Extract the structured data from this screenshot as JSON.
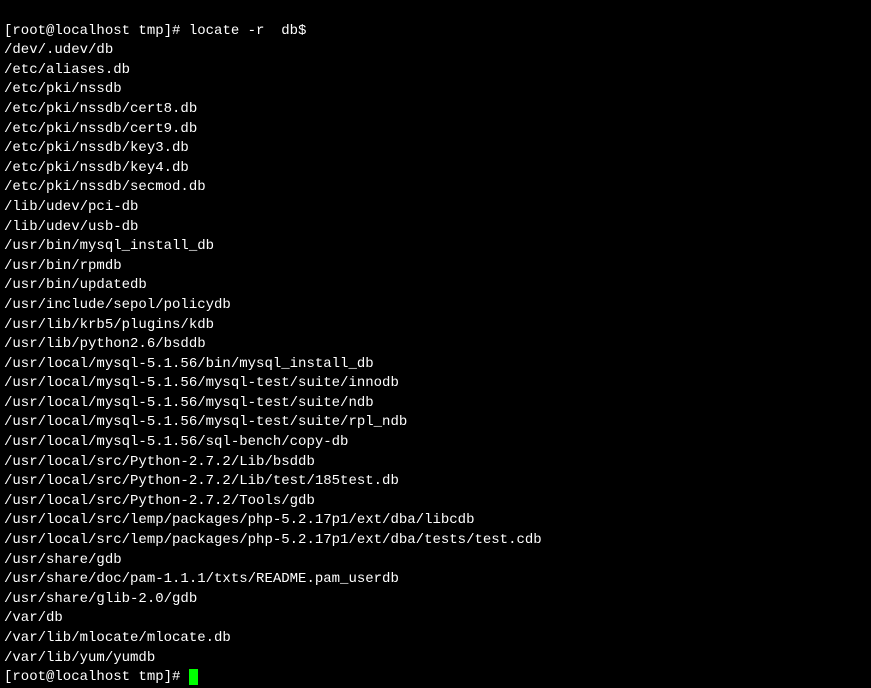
{
  "prompt1": {
    "prefix": "[root@localhost tmp]# ",
    "command": "locate -r  db$"
  },
  "output": [
    "/dev/.udev/db",
    "/etc/aliases.db",
    "/etc/pki/nssdb",
    "/etc/pki/nssdb/cert8.db",
    "/etc/pki/nssdb/cert9.db",
    "/etc/pki/nssdb/key3.db",
    "/etc/pki/nssdb/key4.db",
    "/etc/pki/nssdb/secmod.db",
    "/lib/udev/pci-db",
    "/lib/udev/usb-db",
    "/usr/bin/mysql_install_db",
    "/usr/bin/rpmdb",
    "/usr/bin/updatedb",
    "/usr/include/sepol/policydb",
    "/usr/lib/krb5/plugins/kdb",
    "/usr/lib/python2.6/bsddb",
    "/usr/local/mysql-5.1.56/bin/mysql_install_db",
    "/usr/local/mysql-5.1.56/mysql-test/suite/innodb",
    "/usr/local/mysql-5.1.56/mysql-test/suite/ndb",
    "/usr/local/mysql-5.1.56/mysql-test/suite/rpl_ndb",
    "/usr/local/mysql-5.1.56/sql-bench/copy-db",
    "/usr/local/src/Python-2.7.2/Lib/bsddb",
    "/usr/local/src/Python-2.7.2/Lib/test/185test.db",
    "/usr/local/src/Python-2.7.2/Tools/gdb",
    "/usr/local/src/lemp/packages/php-5.2.17p1/ext/dba/libcdb",
    "/usr/local/src/lemp/packages/php-5.2.17p1/ext/dba/tests/test.cdb",
    "/usr/share/gdb",
    "/usr/share/doc/pam-1.1.1/txts/README.pam_userdb",
    "/usr/share/glib-2.0/gdb",
    "/var/db",
    "/var/lib/mlocate/mlocate.db",
    "/var/lib/yum/yumdb"
  ],
  "prompt2": {
    "prefix": "[root@localhost tmp]# "
  }
}
